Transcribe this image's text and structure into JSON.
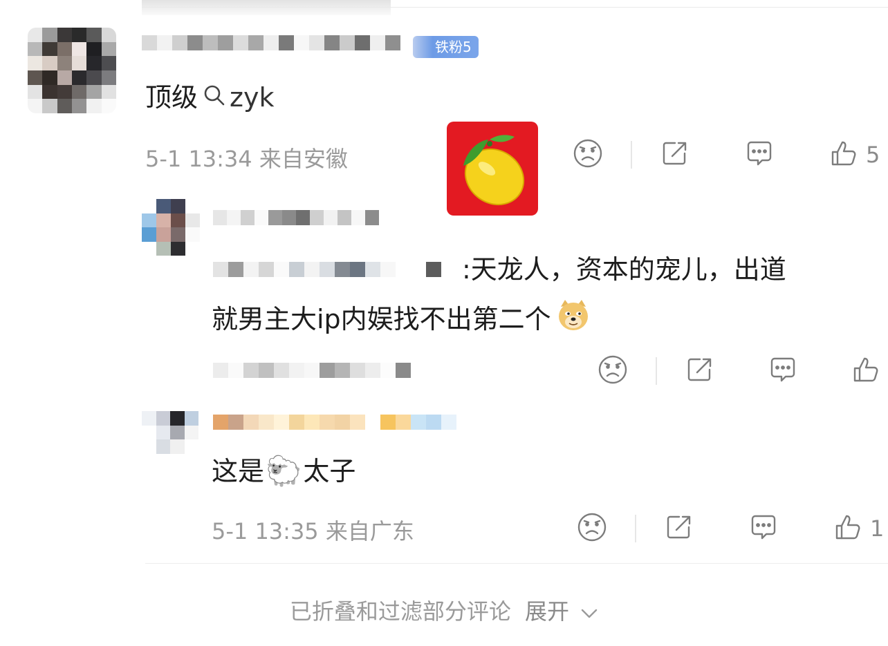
{
  "comments": [
    {
      "badge": "铁粉5",
      "text_before": "顶级",
      "search_term": "zyk",
      "meta": "5-1 13:34 来自安徽",
      "likes": "5"
    },
    {
      "text_line1": ":天龙人，资本的宠儿，出道",
      "text_line2": "就男主大ip内娱找不出第二个",
      "emoji": "doge"
    },
    {
      "text_before": "这是",
      "emoji": "🐑",
      "text_after": "太子",
      "meta": "5-1 13:35 来自广东",
      "likes": "1"
    }
  ],
  "footer": {
    "folded_text": "已折叠和过滤部分评论",
    "expand_label": "展开"
  },
  "icons": [
    "sad-face-icon",
    "share-icon",
    "comment-icon",
    "thumbs-up-icon",
    "search-icon",
    "chevron-down-icon",
    "lemon-sticker",
    "doge-emoji",
    "sheep-emoji"
  ],
  "colors": {
    "badge": "#7aa5ea",
    "sticker_bg": "#e31a22",
    "meta_text": "#9a9a9a"
  }
}
